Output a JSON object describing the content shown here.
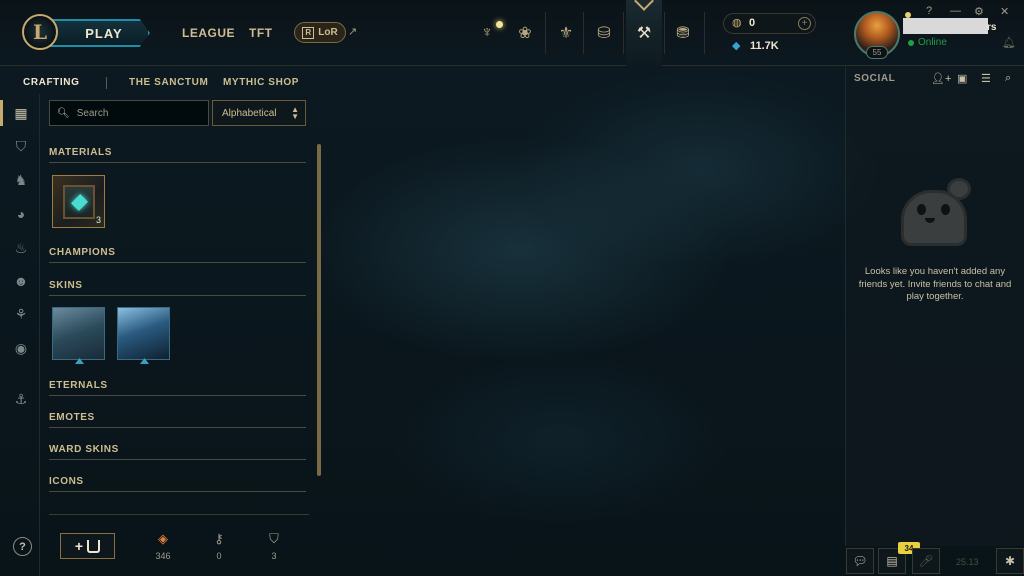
{
  "header": {
    "play_label": "PLAY",
    "nav": [
      "LEAGUE",
      "TFT"
    ],
    "lor_label": "LoR",
    "currency": {
      "rp": "0",
      "be": "11.7K"
    },
    "level": "55",
    "name_suffix": "rs",
    "status": "Online"
  },
  "subnav": {
    "items": [
      "CRAFTING",
      "THE SANCTUM",
      "MYTHIC SHOP"
    ]
  },
  "search": {
    "placeholder": "Search"
  },
  "sort": {
    "selected": "Alphabetical"
  },
  "sections": {
    "materials": "MATERIALS",
    "champions": "CHAMPIONS",
    "skins": "SKINS",
    "eternals": "ETERNALS",
    "emotes": "EMOTES",
    "ward_skins": "WARD SKINS",
    "icons": "ICONS"
  },
  "materials": [
    {
      "count": "3"
    }
  ],
  "footer": {
    "stats": [
      {
        "icon": "orange-essence-icon",
        "value": "346"
      },
      {
        "icon": "key-icon",
        "value": "0"
      },
      {
        "icon": "chest-icon",
        "value": "3"
      }
    ]
  },
  "social": {
    "title": "SOCIAL",
    "empty_message": "Looks like you haven't added any friends yet. Invite friends to chat and play together."
  },
  "notifications": {
    "badge": "34"
  },
  "version": "25.13",
  "colors": {
    "gold": "#c8aa6e",
    "teal": "#1e8fa6",
    "online": "#1ca04a"
  }
}
